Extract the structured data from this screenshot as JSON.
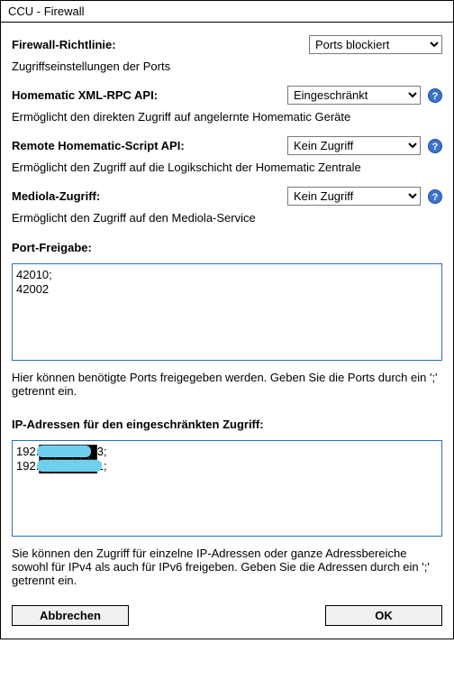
{
  "title": "CCU - Firewall",
  "policy": {
    "label": "Firewall-Richtlinie:",
    "value": "Ports blockiert",
    "desc": "Zugriffseinstellungen der Ports"
  },
  "xmlrpc": {
    "label": "Homematic XML-RPC API:",
    "value": "Eingeschränkt",
    "desc": "Ermöglicht den direkten Zugriff auf angelernte Homematic Geräte"
  },
  "scriptapi": {
    "label": "Remote Homematic-Script API:",
    "value": "Kein Zugriff",
    "desc": "Ermöglicht den Zugriff auf die Logikschicht der Homematic Zentrale"
  },
  "mediola": {
    "label": "Mediola-Zugriff:",
    "value": "Kein Zugriff",
    "desc": "Ermöglicht den Zugriff auf den Mediola-Service"
  },
  "ports": {
    "label": "Port-Freigabe:",
    "value": "42010;\n42002",
    "hint": "Hier können benötigte Ports freigegeben werden. Geben Sie die Ports durch ein ';' getrennt ein."
  },
  "ips": {
    "label": "IP-Adressen für den eingeschränkten Zugriff:",
    "value": "192.███████3;\n192.███████1;",
    "hint": "Sie können den Zugriff für einzelne IP-Adressen oder ganze Adressbereiche sowohl für IPv4 als auch für IPv6 freigeben. Geben Sie die Adressen durch ein ';' getrennt ein."
  },
  "buttons": {
    "cancel": "Abbrechen",
    "ok": "OK"
  }
}
